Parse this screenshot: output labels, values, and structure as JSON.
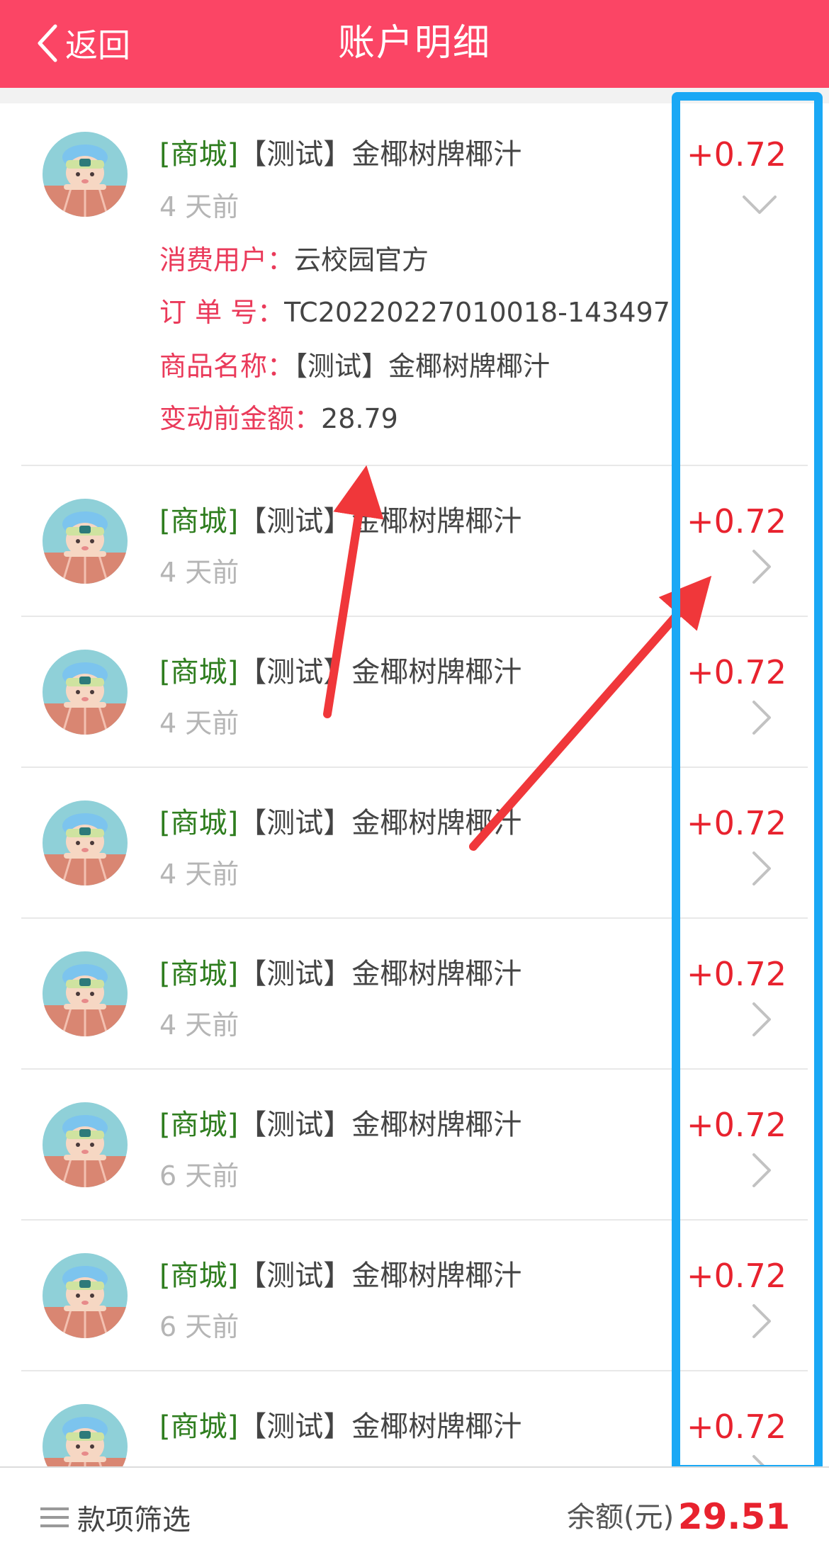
{
  "header": {
    "back_label": "返回",
    "title": "账户明细",
    "bg_color": "#fb4565"
  },
  "expanded_item": {
    "tag": "[商城]",
    "product": "【测试】金椰树牌椰汁",
    "time": "4 天前",
    "amount": "+0.72",
    "details": [
      {
        "label": "消费用户：",
        "value": "云校园官方"
      },
      {
        "label": "订 单 号：",
        "value": "TC20220227010018-143497"
      },
      {
        "label": "商品名称：",
        "value": "【测试】金椰树牌椰汁"
      },
      {
        "label": "变动前金额：",
        "value": "28.79"
      }
    ]
  },
  "items": [
    {
      "tag": "[商城]",
      "product": "【测试】金椰树牌椰汁",
      "time": "4 天前",
      "amount": "+0.72"
    },
    {
      "tag": "[商城]",
      "product": "【测试】金椰树牌椰汁",
      "time": "4 天前",
      "amount": "+0.72"
    },
    {
      "tag": "[商城]",
      "product": "【测试】金椰树牌椰汁",
      "time": "4 天前",
      "amount": "+0.72"
    },
    {
      "tag": "[商城]",
      "product": "【测试】金椰树牌椰汁",
      "time": "4 天前",
      "amount": "+0.72"
    },
    {
      "tag": "[商城]",
      "product": "【测试】金椰树牌椰汁",
      "time": "6 天前",
      "amount": "+0.72"
    },
    {
      "tag": "[商城]",
      "product": "【测试】金椰树牌椰汁",
      "time": "6 天前",
      "amount": "+0.72"
    },
    {
      "tag": "[商城]",
      "product": "【测试】金椰树牌椰汁",
      "time": "",
      "amount": "+0.72"
    }
  ],
  "footer": {
    "filter_label": "款项筛选",
    "balance_label": "余额(元)",
    "balance_value": "29.51"
  },
  "colors": {
    "accent": "#fb4565",
    "amount": "#e8222e",
    "tag": "#2e7d1e",
    "detail_label": "#ea3a5a",
    "annotation_box": "#1aa8f5",
    "annotation_arrow": "#f0373a"
  },
  "icons": {
    "back": "chevron-left-icon",
    "expand": "chevron-down-icon",
    "row": "chevron-right-icon",
    "filter": "menu-lines-icon",
    "avatar": "cartoon-avatar"
  }
}
